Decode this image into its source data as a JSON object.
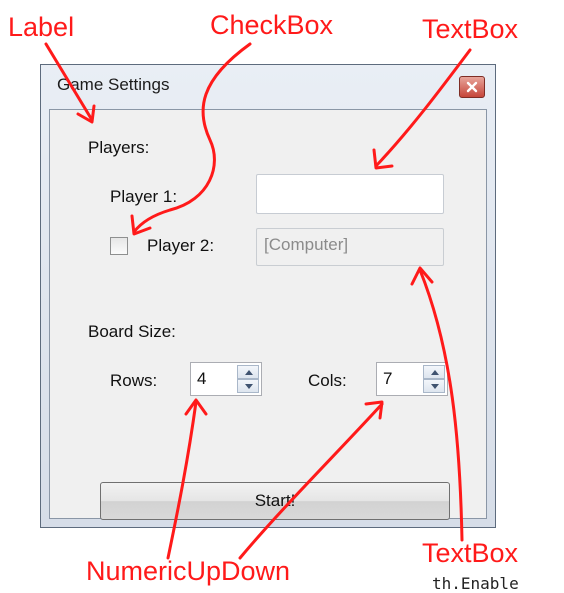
{
  "annotations": {
    "label": "Label",
    "checkbox": "CheckBox",
    "textbox_top": "TextBox",
    "textbox_bottom": "TextBox",
    "numeric": "NumericUpDown",
    "accent_color": "#ff1a1a"
  },
  "background_code": "th.Enable",
  "window": {
    "title": "Game Settings",
    "close_icon": "close-icon"
  },
  "form": {
    "players_label": "Players:",
    "player1_label": "Player 1:",
    "player1_value": "",
    "player2_checked": false,
    "player2_label": "Player 2:",
    "player2_value": "[Computer]",
    "board_size_label": "Board Size:",
    "rows_label": "Rows:",
    "rows_value": "4",
    "cols_label": "Cols:",
    "cols_value": "7",
    "start_label": "Start!"
  }
}
